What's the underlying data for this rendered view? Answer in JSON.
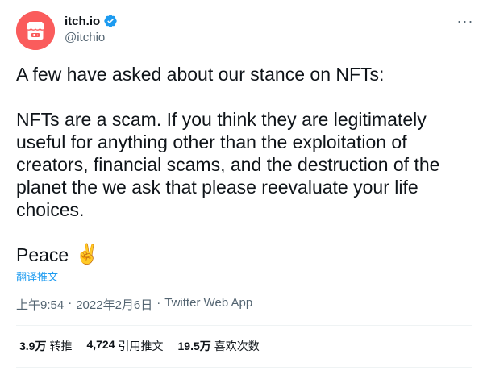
{
  "author": {
    "display_name": "itch.io",
    "handle": "@itchio",
    "avatar_color": "#fa5c5c",
    "verified_color": "#1d9bf0"
  },
  "more_icon": "more-horizontal-icon",
  "more_label": "···",
  "tweet": {
    "paragraph_1": "A few have asked about our stance on NFTs:",
    "paragraph_2": "NFTs are a scam. If you think they are legitimately useful for anything other than the exploitation of creators, financial scams, and the destruction of the planet the we ask that please reevaluate your life choices.",
    "paragraph_3": "Peace",
    "emoji": "✌️"
  },
  "translate_label": "翻译推文",
  "meta": {
    "time": "上午9:54",
    "sep1": "·",
    "date": "2022年2月6日",
    "sep2": "·",
    "source": "Twitter Web App"
  },
  "stats": [
    {
      "count": "3.9万",
      "label": "转推"
    },
    {
      "count": "4,724",
      "label": "引用推文"
    },
    {
      "count": "19.5万",
      "label": "喜欢次数"
    }
  ]
}
